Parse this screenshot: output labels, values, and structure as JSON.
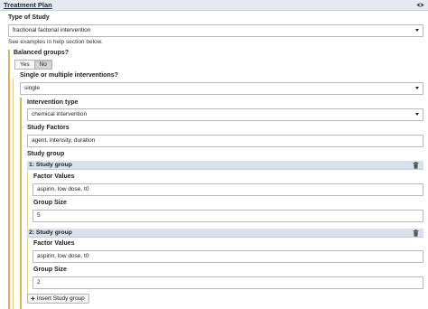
{
  "section": {
    "title": "Treatment Plan",
    "toggle_icon": "eye-icon"
  },
  "type_of_study": {
    "label": "Type of Study",
    "value": "fractional factorial intervention",
    "help": "See examples in help section below."
  },
  "balanced_groups": {
    "label": "Balanced groups?",
    "options": [
      "Yes",
      "No"
    ],
    "selected": "No"
  },
  "interventions": {
    "label": "Single or multiple interventions?",
    "value": "single"
  },
  "intervention_type": {
    "label": "Intervention type",
    "value": "chemical intervention"
  },
  "study_factors": {
    "label": "Study Factors",
    "value": "agent, intensity, duration"
  },
  "study_group": {
    "label": "Study group",
    "groups": [
      {
        "title": "1: Study group",
        "factor_values_label": "Factor Values",
        "factor_values": "aspirin, low dose, t0",
        "group_size_label": "Group Size",
        "group_size": "5"
      },
      {
        "title": "2: Study group",
        "factor_values_label": "Factor Values",
        "factor_values": "aspirin, low dose, t0",
        "group_size_label": "Group Size",
        "group_size": "2"
      }
    ],
    "insert_label": "Insert Study group"
  },
  "colors": {
    "header_bg": "#e4eaf0",
    "repeat_header_bg": "#d9e2ec",
    "nest_bar": "#d9b45c"
  }
}
